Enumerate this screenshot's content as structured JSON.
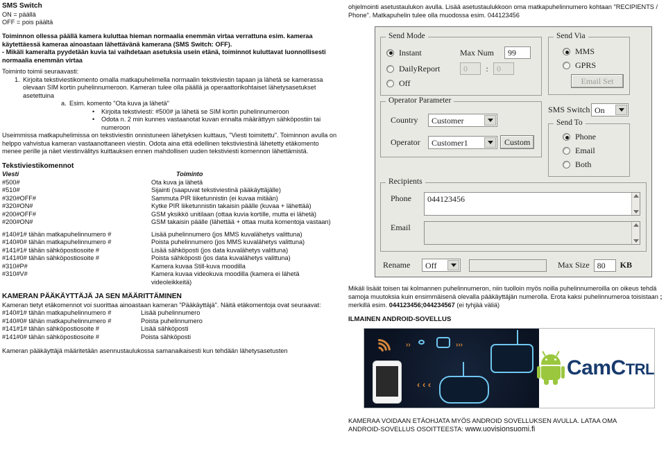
{
  "left": {
    "heading": "SMS Switch",
    "on_line": "ON = päällä",
    "off_line": "OFF = pois päältä",
    "bold_para_1": "Toiminnon ollessa päällä kamera kuluttaa hieman normaalia enemmän virtaa verrattuna esim. kameraa käytettäessä kameraa ainoastaan lähettävänä kamerana (SMS Switch: OFF).",
    "bold_para_2": "- Mikäli kameralta pyydetään kuvia tai vaihdetaan asetuksia usein etänä, toiminnot kuluttavat luonnollisesti normaalia enemmän virtaa",
    "intro": "Toiminto toimii seuraavasti:",
    "step_1_num": "1.",
    "step_1_text": "Kirjoita tekstiviestikomento omalla matkapuhelimella normaalin tekstiviestin tapaan ja lähetä se kamerassa olevaan SIM kortin puhelinnumeroon. Kameran tulee olla päällä ja operaattorikohtaiset lähetysasetukset asetettuina",
    "step_a_mark": "a.",
    "step_a_text": "Esim. komento \"Ota kuva ja lähetä\"",
    "bullets": [
      "Kirjoita tekstiviesti: #500# ja lähetä se SIM kortin puhelinnumeroon",
      "Odota n. 2 min kunnes vastaanotat kuvan ennalta määrättyyn sähköpostiin tai numeroon"
    ],
    "para_after": "Useimmissa matkapuhelimissa on tekstiviestin onnistuneen lähetyksen kuittaus, \"Viesti toimitettu\". Toiminnon avulla on helppo vahvistua kameran vastaanottaneen viestin. Odota aina että edellinen tekstiviestinä lähetetty etäkomento menee perille ja näet viestinvälitys kuittauksen ennen mahdollisen uuden tekstiviesti komennon lähettämistä.",
    "cmd_title": "Tekstiviestikomennot",
    "cmd_header": {
      "col1": "Viesti",
      "col2": "Toiminto"
    },
    "cmd_rows_a": [
      {
        "cmd": "#500#",
        "desc": "Ota kuva ja lähetä"
      },
      {
        "cmd": "#510#",
        "desc": "Sijainti (saapuvat tekstiviestinä pääkäyttäjälle)"
      },
      {
        "cmd": "#320#OFF#",
        "desc": "Sammuta PIR liiketunnistin (ei kuvaa mitään)"
      },
      {
        "cmd": "#320#ON#",
        "desc": "Kytke PIR liiketunnistin takaisin päälle (kuvaa + lähettää)"
      },
      {
        "cmd": "#200#OFF#",
        "desc": "GSM yksikkö unitilaan (ottaa kuvia kortille, mutta ei lähetä)"
      },
      {
        "cmd": "#200#ON#",
        "desc": "GSM takaisin päälle (lähettää + ottaa muita komentoja vastaan)"
      }
    ],
    "cmd_rows_b": [
      {
        "cmd": "#140#1# tähän matkapuhelinnumero #",
        "desc": "Lisää puhelinnumero  (jos MMS kuvalähetys valittuna)"
      },
      {
        "cmd": "#140#0# tähän matkapuhelinnumero #",
        "desc": "Poista puhelinnumero  (jos MMS kuvalähetys valittuna)"
      },
      {
        "cmd": "#141#1# tähän sähköpostiosoite #",
        "desc": "Lisää sähköposti  (jos data  kuvalähetys valittuna)"
      },
      {
        "cmd": "#141#0# tähän sähköpostiosoite #",
        "desc": "Poista sähköposti (jos data kuvalähetys valittuna)"
      },
      {
        "cmd": "#310#P#",
        "desc": "Kamera kuvaa Still-kuva moodilla"
      },
      {
        "cmd": "#310#V#",
        "desc": "Kamera kuvaa videokuva moodilla (kamera ei lähetä videoleikkeitä)"
      }
    ],
    "admin_title": "KAMERAN PÄÄKÄYTTÄJÄ JA SEN MÄÄRITTÄMINEN",
    "admin_intro": "Kameran tietyt etäkomennot  voi suorittaa ainoastaan kameran \"Pääkäyttäjä\". Näitä etäkomentoja ovat seuraavat:",
    "admin_rows": [
      {
        "cmd": "#140#1# tähän matkapuhelinnumero #",
        "desc": "Lisää puhelinnumero"
      },
      {
        "cmd": "#140#0# tähän matkapuhelinnumero #",
        "desc": "Poista puhelinnumero"
      },
      {
        "cmd": "#141#1# tähän sähköpostiosoite #",
        "desc": "Lisää sähköposti"
      },
      {
        "cmd": "#141#0# tähän sähköpostiosoite #",
        "desc": "Poista sähköposti"
      }
    ],
    "admin_footer": "Kameran pääkäyttäjä määritetään asennustaulukossa samanaikaisesti kun tehdään lähetysasetusten"
  },
  "right": {
    "top_para": "ohjelmointi asetustaulukon avulla. Lisää asetustaulukkoon oma matkapuhelinnumero kohtaan \"RECIPIENTS / Phone\". Matkapuhelin tulee olla muodossa esim. 044123456",
    "dialog": {
      "send_mode": {
        "caption": "Send Mode",
        "options": [
          {
            "label": "Instant",
            "selected": true
          },
          {
            "label": "DailyReport",
            "selected": false
          },
          {
            "label": "Off",
            "selected": false
          }
        ],
        "max_num_label": "Max Num",
        "max_num_value": "99",
        "daily_hour": "0",
        "daily_sep": ":",
        "daily_min": "0"
      },
      "send_via": {
        "caption": "Send Via",
        "options": [
          {
            "label": "MMS",
            "selected": true
          },
          {
            "label": "GPRS",
            "selected": false
          }
        ],
        "email_set_button": "Email Set"
      },
      "sms_switch": {
        "label": "SMS Switch",
        "value": "On"
      },
      "send_to": {
        "caption": "Send To",
        "options": [
          {
            "label": "Phone",
            "selected": true
          },
          {
            "label": "Email",
            "selected": false
          },
          {
            "label": "Both",
            "selected": false
          }
        ]
      },
      "operator_parameter": {
        "caption": "Operator Parameter",
        "country_label": "Country",
        "country_value": "Customer",
        "operator_label": "Operator",
        "operator_value": "Customer1",
        "custom_button": "Custom"
      },
      "recipients": {
        "caption": "Recipients",
        "phone_label": "Phone",
        "phone_value": "044123456",
        "email_label": "Email",
        "email_value": ""
      },
      "footer": {
        "rename_label": "Rename",
        "rename_value": "Off",
        "rename_text": "",
        "max_size_label": "Max Size",
        "max_size_value": "80",
        "max_size_unit": "KB"
      }
    },
    "note_line_1": "Mikäli lisäät toisen tai kolmannen puhelinnumeron, niin tuolloin myös noilla puhelinnumeroilla on oikeus tehdä samoja muutoksia kuin ensimmäisenä olevalla pääkäyttäjän numerolla. Erota kaksi puhelinnumeroa toisistaan ",
    "note_semicolon": ";",
    "note_line_2": " merkillä esim. ",
    "note_bold": "044123456;044234567",
    "note_tail": " (ei tyhjää väliä)",
    "android_title": "ILMAINEN ANDROID-SOVELLUS",
    "banner": {
      "logo_cam": "Cam",
      "logo_c": "C",
      "logo_trl": "TRL"
    },
    "bottom_line_1": "KAMERAA VOIDAAN ETÄOHJATA MYÖS ANDROID SOVELLUKSEN AVULLA. LATAA OMA",
    "bottom_line_2_pre": "ANDROID-SOVELLUS OSOITTEESTA: ",
    "bottom_url": "www.uovisionsuomi.fi"
  }
}
